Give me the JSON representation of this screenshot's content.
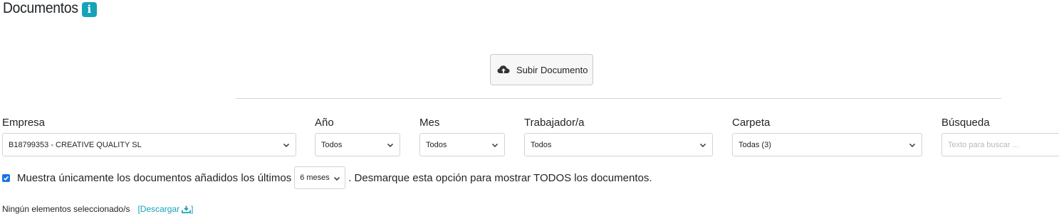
{
  "header": {
    "title": "Documentos",
    "info_icon": "info-icon",
    "info_glyph": "i"
  },
  "upload": {
    "label": "Subir Documento",
    "icon": "cloud-upload-icon"
  },
  "filters": {
    "empresa": {
      "label": "Empresa",
      "value": "B18799353 - CREATIVE QUALITY SL"
    },
    "anio": {
      "label": "Año",
      "value": "Todos"
    },
    "mes": {
      "label": "Mes",
      "value": "Todos"
    },
    "trabajador": {
      "label": "Trabajador/a",
      "value": "Todos"
    },
    "carpeta": {
      "label": "Carpeta",
      "value": "Todas (3)"
    },
    "busqueda": {
      "label": "Búsqueda",
      "placeholder": "Texto para buscar ..."
    }
  },
  "recent_filter": {
    "checked": true,
    "text_before": "Muestra únicamente los documentos añadidos los últimos",
    "months_value": "6 meses",
    "text_after": ". Desmarque esta opción para mostrar TODOS los documentos."
  },
  "selection": {
    "status": "Ningún elementos seleccionado/s",
    "download_open": "[",
    "download_label": "Descargar",
    "download_close": "]",
    "download_icon": "download-icon"
  },
  "colors": {
    "accent": "#17a2b8",
    "checkbox": "#1a73e8"
  }
}
